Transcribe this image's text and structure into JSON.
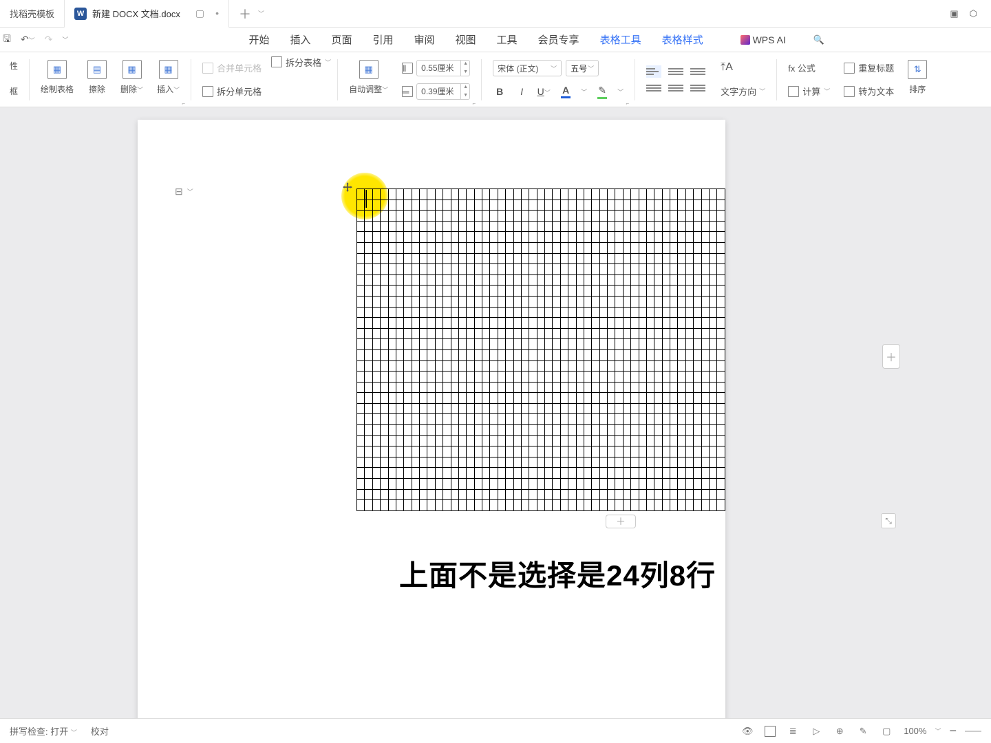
{
  "tabs": {
    "template_tab": "找稻壳模板",
    "doc_tab": "新建 DOCX 文档.docx",
    "doc_icon_letter": "W"
  },
  "menu": {
    "start": "开始",
    "insert": "插入",
    "page": "页面",
    "reference": "引用",
    "review": "审阅",
    "view": "视图",
    "tools": "工具",
    "member": "会员专享",
    "table_tools": "表格工具",
    "table_style": "表格样式",
    "wps_ai": "WPS AI"
  },
  "ribbon": {
    "props": "性",
    "frame": "框",
    "draw_table": "绘制表格",
    "erase": "擦除",
    "delete": "删除",
    "insert": "插入",
    "merge_cells": "合并单元格",
    "split_table": "拆分表格",
    "split_cells": "拆分单元格",
    "auto_fit": "自动调整",
    "height_value": "0.55厘米",
    "width_value": "0.39厘米",
    "font_name": "宋体 (正文)",
    "font_size": "五号",
    "bold": "B",
    "italic": "I",
    "underline": "U",
    "text_direction": "文字方向",
    "formula": "fx 公式",
    "calc": "计算",
    "repeat_header": "重复标题",
    "to_text": "转为文本",
    "sort": "排序"
  },
  "page_content": {
    "caption": "上面不是选择是24列8行"
  },
  "statusbar": {
    "spellcheck": "拼写检查: 打开",
    "proofread": "校对",
    "zoom": "100%"
  },
  "colors": {
    "font_color": "#1e5cd8",
    "highlight_color": "#5fcf5f"
  }
}
